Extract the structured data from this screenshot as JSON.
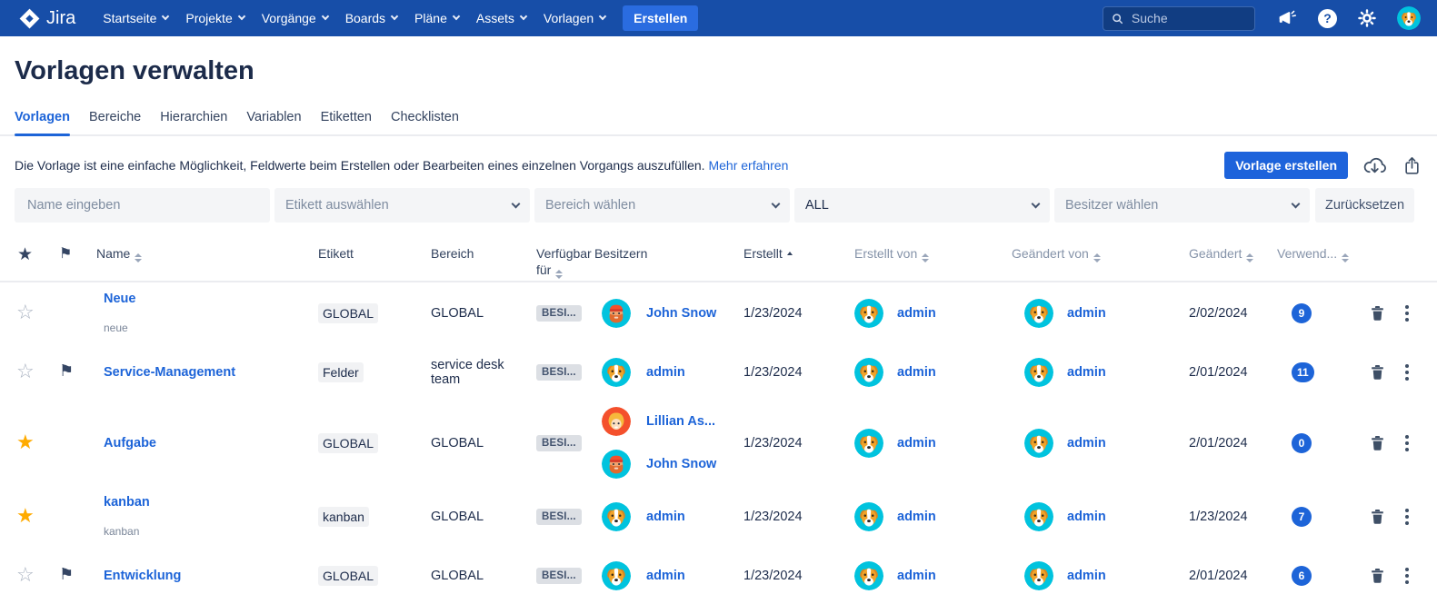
{
  "navbar": {
    "logo_text": "Jira",
    "items": [
      "Startseite",
      "Projekte",
      "Vorgänge",
      "Boards",
      "Pläne",
      "Assets",
      "Vorlagen"
    ],
    "create_label": "Erstellen",
    "search_placeholder": "Suche"
  },
  "page": {
    "title": "Vorlagen verwalten",
    "tabs": [
      "Vorlagen",
      "Bereiche",
      "Hierarchien",
      "Variablen",
      "Etiketten",
      "Checklisten"
    ],
    "active_tab": "Vorlagen",
    "description": "Die Vorlage ist eine einfache Möglichkeit, Feldwerte beim Erstellen oder Bearbeiten eines einzelnen Vorgangs auszufüllen.",
    "learn_more": "Mehr erfahren",
    "create_template_label": "Vorlage erstellen"
  },
  "filters": {
    "name_placeholder": "Name eingeben",
    "etikett_placeholder": "Etikett auswählen",
    "bereich_placeholder": "Bereich wählen",
    "scope_value": "ALL",
    "besitzer_placeholder": "Besitzer wählen",
    "reset_label": "Zurücksetzen"
  },
  "table": {
    "columns": [
      {
        "key": "star",
        "icon": "star"
      },
      {
        "key": "flag",
        "icon": "flag"
      },
      {
        "key": "name",
        "label": "Name",
        "sort": "both"
      },
      {
        "key": "etikett",
        "label": "Etikett"
      },
      {
        "key": "bereich",
        "label": "Bereich"
      },
      {
        "key": "verfuegbar",
        "label": "Verfügbar für",
        "sort": "both"
      },
      {
        "key": "besitzern",
        "label": "Besitzern"
      },
      {
        "key": "erstellt",
        "label": "Erstellt",
        "sort": "asc"
      },
      {
        "key": "erstellt_von",
        "label": "Erstellt von",
        "sort": "both",
        "muted": true
      },
      {
        "key": "geaendert_von",
        "label": "Geändert von",
        "sort": "both",
        "muted": true
      },
      {
        "key": "geaendert",
        "label": "Geändert",
        "sort": "both",
        "muted": true
      },
      {
        "key": "verwendet",
        "label": "Verwend...",
        "sort": "both",
        "muted": true
      },
      {
        "key": "delete"
      },
      {
        "key": "menu"
      }
    ],
    "rows": [
      {
        "starred": false,
        "flagged": false,
        "name": "Neue",
        "subtitle": "neue",
        "etikett": "GLOBAL",
        "bereich": "GLOBAL",
        "verfuegbar": "BESI...",
        "owners": [
          {
            "name": "John Snow",
            "avatar": "john-snow"
          }
        ],
        "erstellt": "1/23/2024",
        "erstellt_von": {
          "name": "admin",
          "avatar": "dog"
        },
        "geaendert_von": {
          "name": "admin",
          "avatar": "dog"
        },
        "geaendert": "2/02/2024",
        "verwendet": "9"
      },
      {
        "starred": false,
        "flagged": true,
        "name": "Service-Management",
        "subtitle": "",
        "etikett": "Felder",
        "bereich": "service desk team",
        "verfuegbar": "BESI...",
        "owners": [
          {
            "name": "admin",
            "avatar": "dog"
          }
        ],
        "erstellt": "1/23/2024",
        "erstellt_von": {
          "name": "admin",
          "avatar": "dog"
        },
        "geaendert_von": {
          "name": "admin",
          "avatar": "dog"
        },
        "geaendert": "2/01/2024",
        "verwendet": "11"
      },
      {
        "starred": true,
        "flagged": false,
        "name": "Aufgabe",
        "subtitle": "",
        "etikett": "GLOBAL",
        "bereich": "GLOBAL",
        "verfuegbar": "BESI...",
        "owners": [
          {
            "name": "Lillian As...",
            "avatar": "lillian"
          },
          {
            "name": "John Snow",
            "avatar": "john-snow"
          }
        ],
        "erstellt": "1/23/2024",
        "erstellt_von": {
          "name": "admin",
          "avatar": "dog"
        },
        "geaendert_von": {
          "name": "admin",
          "avatar": "dog"
        },
        "geaendert": "2/01/2024",
        "verwendet": "0"
      },
      {
        "starred": true,
        "flagged": false,
        "name": "kanban",
        "subtitle": "kanban",
        "etikett": "kanban",
        "bereich": "GLOBAL",
        "verfuegbar": "BESI...",
        "owners": [
          {
            "name": "admin",
            "avatar": "dog"
          }
        ],
        "erstellt": "1/23/2024",
        "erstellt_von": {
          "name": "admin",
          "avatar": "dog"
        },
        "geaendert_von": {
          "name": "admin",
          "avatar": "dog"
        },
        "geaendert": "1/23/2024",
        "verwendet": "7"
      },
      {
        "starred": false,
        "flagged": true,
        "name": "Entwicklung",
        "subtitle": "",
        "etikett": "GLOBAL",
        "bereich": "GLOBAL",
        "verfuegbar": "BESI...",
        "owners": [
          {
            "name": "admin",
            "avatar": "dog"
          }
        ],
        "erstellt": "1/23/2024",
        "erstellt_von": {
          "name": "admin",
          "avatar": "dog"
        },
        "geaendert_von": {
          "name": "admin",
          "avatar": "dog"
        },
        "geaendert": "2/01/2024",
        "verwendet": "6"
      }
    ]
  },
  "colors": {
    "navbar_bg": "#174EA8",
    "accent_blue": "#1D63DB",
    "link_blue": "#1D64D8",
    "star_yellow": "#FFAB00",
    "badge_bg": "#1D64D8"
  }
}
